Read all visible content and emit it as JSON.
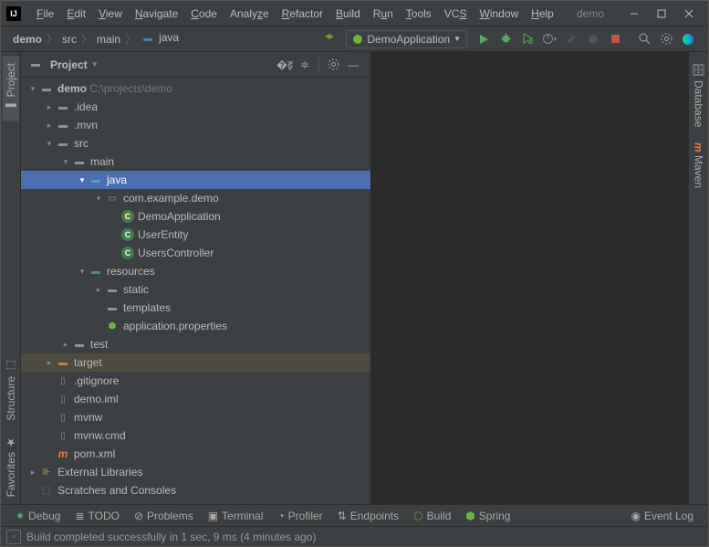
{
  "menubar": {
    "items": [
      "File",
      "Edit",
      "View",
      "Navigate",
      "Code",
      "Analyze",
      "Refactor",
      "Build",
      "Run",
      "Tools",
      "VCS",
      "Window",
      "Help"
    ]
  },
  "window": {
    "title": "demo"
  },
  "breadcrumbs": {
    "items": [
      "demo",
      "src",
      "main",
      "java"
    ]
  },
  "run_config": {
    "label": "DemoApplication"
  },
  "project_panel": {
    "title": "Project"
  },
  "tree": {
    "root": {
      "name": "demo",
      "path": "C:\\projects\\demo"
    },
    "idea": ".idea",
    "mvn": ".mvn",
    "src": "src",
    "main": "main",
    "java": "java",
    "pkg": "com.example.demo",
    "cls1": "DemoApplication",
    "cls2": "UserEntity",
    "cls3": "UsersController",
    "resources": "resources",
    "static": "static",
    "templates": "templates",
    "appprops": "application.properties",
    "test": "test",
    "target": "target",
    "gitignore": ".gitignore",
    "iml": "demo.iml",
    "mvnw": "mvnw",
    "mvnwcmd": "mvnw.cmd",
    "pom": "pom.xml",
    "extlib": "External Libraries",
    "scratches": "Scratches and Consoles"
  },
  "left_tabs": {
    "project": "Project",
    "structure": "Structure",
    "favorites": "Favorites"
  },
  "right_tabs": {
    "database": "Database",
    "maven": "Maven"
  },
  "bottom_tabs": {
    "debug": "Debug",
    "todo": "TODO",
    "problems": "Problems",
    "terminal": "Terminal",
    "profiler": "Profiler",
    "endpoints": "Endpoints",
    "build": "Build",
    "spring": "Spring",
    "eventlog": "Event Log"
  },
  "status": {
    "text": "Build completed successfully in 1 sec, 9 ms (4 minutes ago)"
  }
}
